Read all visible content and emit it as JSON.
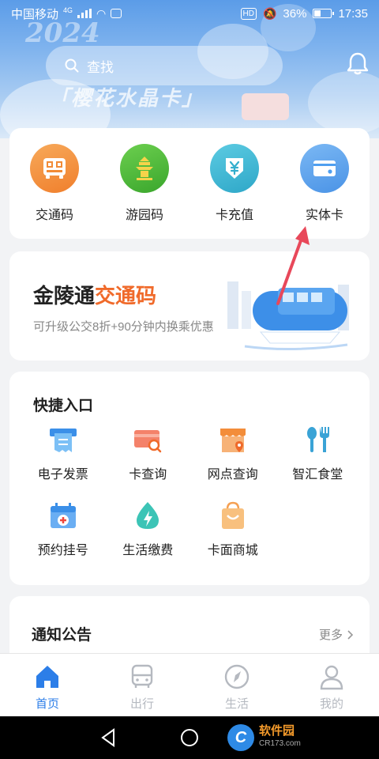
{
  "status_bar": {
    "carrier": "中国移动",
    "network": "4G",
    "battery": "36%",
    "battery_level": 0.36,
    "time": "17:35"
  },
  "banner": {
    "year_text": "2024",
    "slogan_text": "「樱花水晶卡」"
  },
  "search": {
    "placeholder": "查找"
  },
  "top_actions": [
    {
      "label": "交通码",
      "icon": "qr-bus-icon",
      "color": "#f4943f"
    },
    {
      "label": "游园码",
      "icon": "pavilion-icon",
      "color": "#4dbb3c"
    },
    {
      "label": "卡充值",
      "icon": "yen-recharge-icon",
      "color": "#3fb8d6"
    },
    {
      "label": "实体卡",
      "icon": "card-icon",
      "color": "#4f9ff0"
    }
  ],
  "promo": {
    "title_main": "金陵通",
    "title_highlight": "交通码",
    "subtitle": "可升级公交8折+90分钟内换乘优惠"
  },
  "quick_entry": {
    "title": "快捷入口",
    "items": [
      {
        "label": "电子发票",
        "icon": "invoice-icon"
      },
      {
        "label": "卡查询",
        "icon": "card-search-icon"
      },
      {
        "label": "网点查询",
        "icon": "store-location-icon"
      },
      {
        "label": "智汇食堂",
        "icon": "spoon-fork-icon"
      },
      {
        "label": "预约挂号",
        "icon": "hospital-calendar-icon"
      },
      {
        "label": "生活缴费",
        "icon": "water-drop-bolt-icon"
      },
      {
        "label": "卡面商城",
        "icon": "shopping-bag-icon"
      }
    ]
  },
  "notice": {
    "title": "通知公告",
    "more_label": "更多"
  },
  "tabs": [
    {
      "label": "首页",
      "icon": "home-icon",
      "active": true
    },
    {
      "label": "出行",
      "icon": "bus-icon",
      "active": false
    },
    {
      "label": "生活",
      "icon": "compass-icon",
      "active": false
    },
    {
      "label": "我的",
      "icon": "person-icon",
      "active": false
    }
  ],
  "watermark": {
    "text": "软件园",
    "sub": "CR173.com"
  },
  "colors": {
    "accent": "#2c7ee8",
    "highlight": "#f06a2a",
    "arrow": "#e8485a"
  }
}
